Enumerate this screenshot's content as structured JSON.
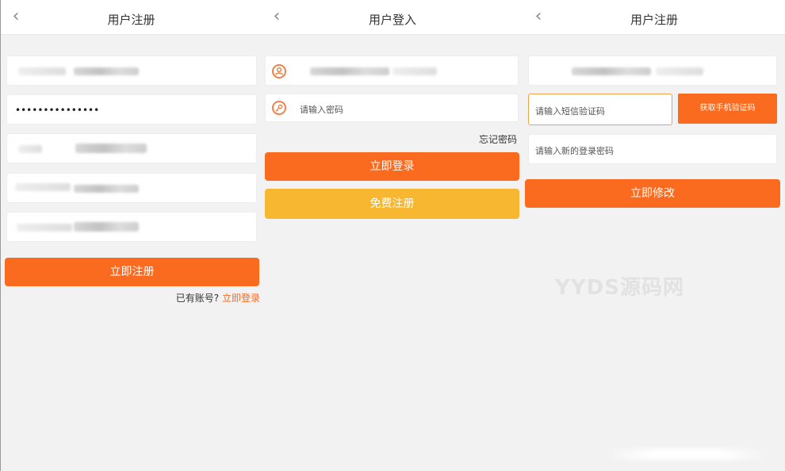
{
  "panel_register": {
    "back_glyph": "‹",
    "title": "用户注册",
    "password_mask": "•••••••••••••••",
    "submit_label": "立即注册",
    "have_account_text": "已有账号?",
    "login_link": "立即登录"
  },
  "panel_login": {
    "back_glyph": "‹",
    "title": "用户登入",
    "password_placeholder": "请输入密码",
    "forgot_label": "忘记密码",
    "login_label": "立即登录",
    "register_label": "免费注册",
    "user_icon": "user-icon",
    "key_icon": "key-icon"
  },
  "panel_reset": {
    "back_glyph": "‹",
    "title": "用户注册",
    "sms_placeholder": "请输入短信验证码",
    "get_code_label": "获取手机验证码",
    "new_password_placeholder": "请输入新的登录密码",
    "submit_label": "立即修改"
  },
  "watermark": "YYDS源码网",
  "colors": {
    "accent_orange": "#fa6a1f",
    "accent_yellow": "#f7b731",
    "background": "#f2f2f2"
  }
}
